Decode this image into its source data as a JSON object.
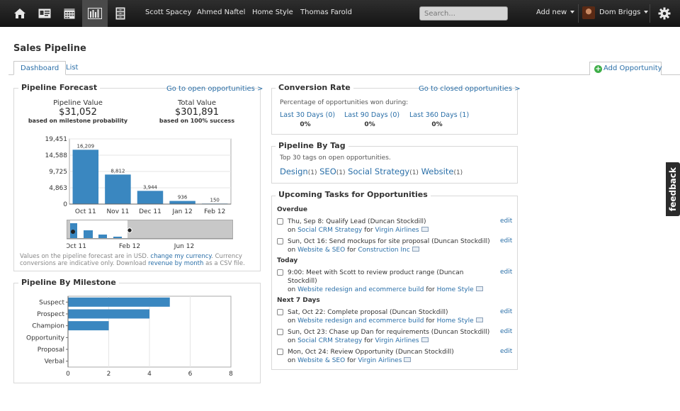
{
  "topbar": {
    "people": [
      "Scott Spacey",
      "Ahmed Naftel",
      "Home Style",
      "Thomas Farold"
    ],
    "search_placeholder": "Search...",
    "add_new": "Add new",
    "user": "Dom Briggs"
  },
  "page": {
    "title": "Sales Pipeline",
    "tabs": [
      "Dashboard",
      "List"
    ],
    "add_opportunity": "Add Opportunity",
    "feedback": "feedback"
  },
  "forecast": {
    "title": "Pipeline Forecast",
    "link": "Go to open opportunities >",
    "pipeline_label": "Pipeline Value",
    "pipeline_value": "$31,052",
    "pipeline_basis": "based on milestone probability",
    "total_label": "Total Value",
    "total_value": "$301,891",
    "total_basis": "based on 100% success",
    "note_1": "Values on the pipeline forecast are in USD.",
    "note_link_1": "change my currency",
    "note_2": ". Currency",
    "note_3": "conversions are indicative only. Download",
    "note_link_2": "revenue by month",
    "note_4": "as a CSV file.",
    "range_labels": [
      "Oct 11",
      "Feb 12",
      "Jun 12"
    ]
  },
  "milestone": {
    "title": "Pipeline By Milestone"
  },
  "conversion": {
    "title": "Conversion Rate",
    "link": "Go to closed opportunities >",
    "subtitle": "Percentage of opportunities won during:",
    "periods": [
      {
        "label": "Last 30 Days (0)",
        "value": "0%"
      },
      {
        "label": "Last 90 Days (0)",
        "value": "0%"
      },
      {
        "label": "Last 360 Days (1)",
        "value": "0%"
      }
    ]
  },
  "tags": {
    "title": "Pipeline By Tag",
    "subtitle": "Top 30 tags on open opportunities.",
    "items": [
      {
        "name": "Design",
        "count": "(1)"
      },
      {
        "name": "SEO",
        "count": "(1)"
      },
      {
        "name": "Social Strategy",
        "count": "(1)"
      },
      {
        "name": "Website",
        "count": "(1)"
      }
    ]
  },
  "tasks": {
    "title": "Upcoming Tasks for Opportunities",
    "edit_label": "edit",
    "on": "on",
    "for": "for",
    "groups": [
      {
        "heading": "Overdue",
        "items": [
          {
            "text": "Thu, Sep 8: Qualify Lead (Duncan Stockdill)",
            "opportunity": "Social CRM Strategy",
            "party": "Virgin Airlines"
          },
          {
            "text": "Sun, Oct 16: Send mockups for site proposal (Duncan Stockdill)",
            "opportunity": "Website & SEO",
            "party": "Construction Inc"
          }
        ]
      },
      {
        "heading": "Today",
        "items": [
          {
            "text": "9:00: Meet with Scott to review product range (Duncan",
            "text_2": "Stockdill)",
            "opportunity": "Website redesign and ecommerce build",
            "party": "Home Style"
          }
        ]
      },
      {
        "heading": "Next 7 Days",
        "items": [
          {
            "text": "Sat, Oct 22: Complete proposal (Duncan Stockdill)",
            "opportunity": "Website redesign and ecommerce build",
            "party": "Home Style"
          },
          {
            "text": "Sun, Oct 23: Chase up Dan for requirements (Duncan Stockdill)",
            "opportunity": "Social CRM Strategy",
            "party": "Virgin Airlines"
          },
          {
            "text": "Mon, Oct 24: Review Opportunity (Duncan Stockdill)",
            "opportunity": "Website & SEO",
            "party": "Virgin Airlines"
          }
        ]
      }
    ]
  },
  "colors": {
    "bar": "#3a87c0",
    "accent": "#2a6fa8",
    "topbar": "#1c1c1c"
  },
  "chart_data": [
    {
      "type": "bar",
      "categories": [
        "Oct 11",
        "Nov 11",
        "Dec 11",
        "Jan 12",
        "Feb 12"
      ],
      "values": [
        16209,
        8812,
        3944,
        936,
        150
      ],
      "ytick_labels": [
        "19,451",
        "14,588",
        "9,725",
        "4,863",
        "0"
      ],
      "yticks": [
        19451,
        14588,
        9725,
        4863,
        0
      ],
      "ylim": [
        0,
        19451
      ],
      "data_labels": [
        "16,209",
        "8,812",
        "3,944",
        "936",
        "150"
      ],
      "grid": true
    },
    {
      "type": "bar",
      "orientation": "horizontal",
      "categories": [
        "Suspect",
        "Prospect",
        "Champion",
        "Opportunity",
        "Proposal",
        "Verbal"
      ],
      "values": [
        5,
        4,
        2,
        0,
        0,
        0
      ],
      "xlim": [
        0,
        8
      ],
      "xticks": [
        0,
        2,
        4,
        6,
        8
      ],
      "grid": true
    }
  ]
}
